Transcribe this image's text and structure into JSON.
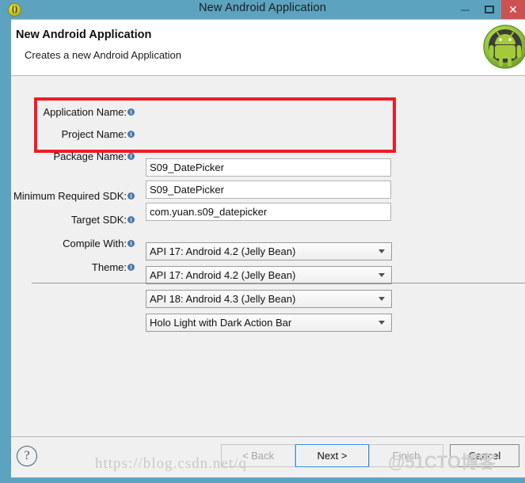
{
  "window": {
    "title": "New Android Application",
    "app_icon": "eclipse-braces-icon",
    "minimize_label": "–",
    "maximize_label": "□",
    "close_label": "✕"
  },
  "header": {
    "title": "New Android Application",
    "subtitle": "Creates a new Android Application",
    "logo": "android-robot-icon"
  },
  "form": {
    "text_fields": [
      {
        "label": "Application Name:",
        "value": "S09_DatePicker",
        "info_icon": "info-icon"
      },
      {
        "label": "Project Name:",
        "value": "S09_DatePicker",
        "info_icon": "info-icon"
      },
      {
        "label": "Package Name:",
        "value": "com.yuan.s09_datepicker",
        "info_icon": "info-icon"
      }
    ],
    "dropdowns": [
      {
        "label": "Minimum Required SDK:",
        "value": "API 17: Android 4.2 (Jelly Bean)",
        "info_icon": "info-icon",
        "arrow_icon": "chevron-down-icon"
      },
      {
        "label": "Target SDK:",
        "value": "API 17: Android 4.2 (Jelly Bean)",
        "info_icon": "info-icon",
        "arrow_icon": "chevron-down-icon"
      },
      {
        "label": "Compile With:",
        "value": "API 18: Android 4.3 (Jelly Bean)",
        "info_icon": "info-icon",
        "arrow_icon": "chevron-down-icon"
      },
      {
        "label": "Theme:",
        "value": "Holo Light with Dark Action Bar",
        "info_icon": "info-icon",
        "arrow_icon": "chevron-down-icon"
      }
    ],
    "highlight_color": "#ee1c25"
  },
  "footer": {
    "help_label": "?",
    "buttons": [
      {
        "label": "< Back",
        "state": "disabled"
      },
      {
        "label": "Next >",
        "state": "focused"
      },
      {
        "label": "Finish",
        "state": "disabled"
      },
      {
        "label": "Cancel",
        "state": "enabled"
      }
    ]
  },
  "watermark": {
    "url": "https://blog.csdn.net/q",
    "overlay": "@51CTO博客"
  },
  "colors": {
    "titlebar": "#5ba3bf",
    "close_button": "#cd5150",
    "dialog_bg": "#f0f0f0",
    "accent_focus": "#2e8de0",
    "highlight": "#ee1c25"
  }
}
